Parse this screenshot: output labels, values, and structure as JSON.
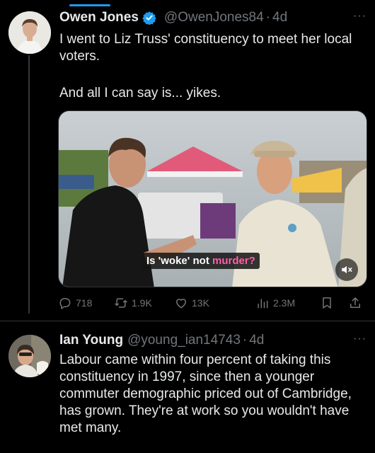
{
  "tweet1": {
    "name": "Owen Jones",
    "handle": "@OwenJones84",
    "separator": "·",
    "time": "4d",
    "text_line1": "I went to Liz Truss' constituency to meet her local voters.",
    "text_line2": "And all I can say is... yikes.",
    "media": {
      "caption_plain": "Is 'woke' not ",
      "caption_highlight": "murder?"
    },
    "actions": {
      "replies": "718",
      "retweets": "1.9K",
      "likes": "13K",
      "views": "2.3M"
    },
    "more": "···"
  },
  "tweet2": {
    "name": "Ian Young",
    "handle": "@young_ian14743",
    "separator": "·",
    "time": "4d",
    "text": "Labour came within four percent of taking this constituency in 1997, since then a younger commuter demographic priced out of Cambridge, has grown. They're at work so you wouldn't have met many.",
    "more": "···"
  },
  "colors": {
    "background": "#000000",
    "text": "#e7e9ea",
    "muted": "#71767b",
    "accent": "#1d9bf0",
    "highlight": "#ff5fa8"
  }
}
